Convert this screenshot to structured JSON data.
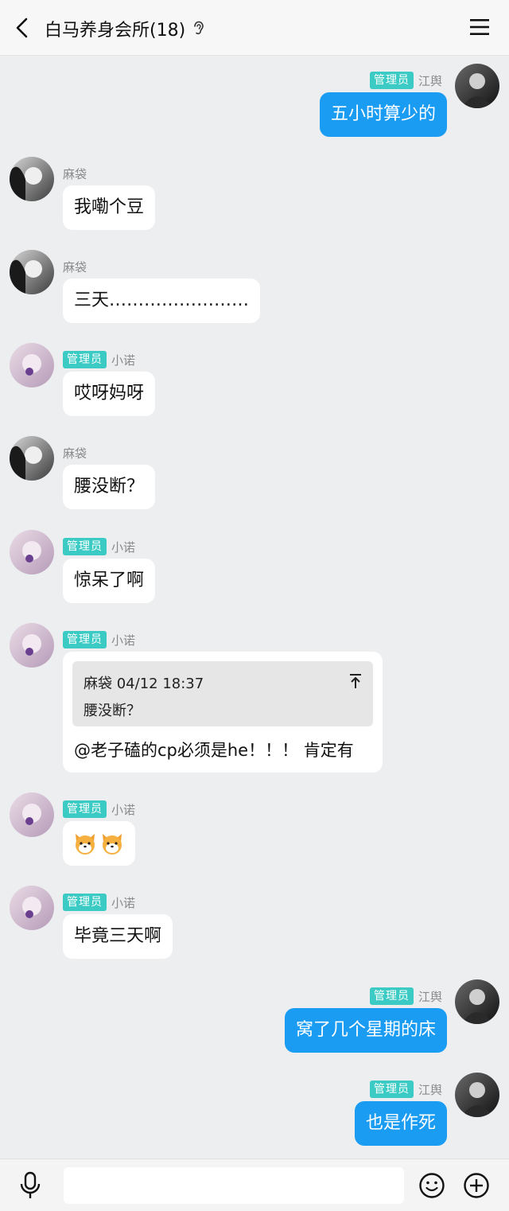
{
  "header": {
    "title": "白马养身会所(18)",
    "back_icon": "chevron-left-icon",
    "ear_icon": "ear-icon",
    "menu_icon": "hamburger-menu-icon"
  },
  "colors": {
    "admin_badge": "#3ccbc4",
    "own_bubble": "#1b9cf3",
    "other_bubble": "#ffffff",
    "background": "#eceef0"
  },
  "messages": [
    {
      "side": "right",
      "badge": "管理员",
      "sender": "江舆",
      "text": "五小时算少的"
    },
    {
      "side": "left",
      "badge": "",
      "sender": "麻袋",
      "text": "我嘞个豆"
    },
    {
      "side": "left",
      "badge": "",
      "sender": "麻袋",
      "text": "三天……………………"
    },
    {
      "side": "left",
      "badge": "管理员",
      "sender": "小诺",
      "text": "哎呀妈呀"
    },
    {
      "side": "left",
      "badge": "",
      "sender": "麻袋",
      "text": "腰没断？"
    },
    {
      "side": "left",
      "badge": "管理员",
      "sender": "小诺",
      "text": "惊呆了啊"
    },
    {
      "side": "left",
      "badge": "管理员",
      "sender": "小诺",
      "quote": {
        "header": "麻袋 04/12 18:37",
        "text": "腰没断？"
      },
      "text": "@老子磕的cp必须是he！！！ 肯定有"
    },
    {
      "side": "left",
      "badge": "管理员",
      "sender": "小诺",
      "emoji": [
        "shiba-dog-emoji",
        "shiba-dog-emoji"
      ]
    },
    {
      "side": "left",
      "badge": "管理员",
      "sender": "小诺",
      "text": "毕竟三天啊"
    },
    {
      "side": "right",
      "badge": "管理员",
      "sender": "江舆",
      "text": "窝了几个星期的床"
    },
    {
      "side": "right",
      "badge": "管理员",
      "sender": "江舆",
      "text": "也是作死"
    }
  ],
  "input_bar": {
    "text_value": "",
    "mic_icon": "microphone-icon",
    "emoji_icon": "smiley-icon",
    "plus_icon": "plus-circle-icon"
  }
}
